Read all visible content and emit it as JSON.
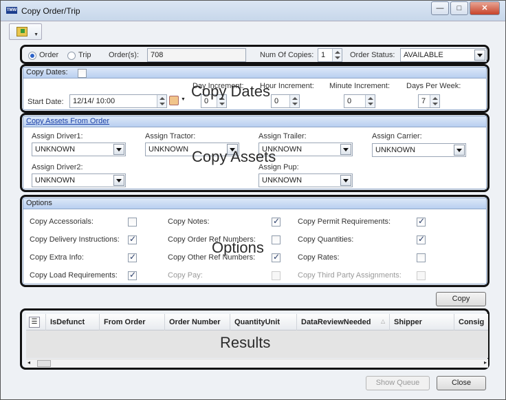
{
  "window": {
    "title": "Copy Order/Trip",
    "icon_label": "TMW"
  },
  "header": {
    "order_radio": "Order",
    "trip_radio": "Trip",
    "orders_label": "Order(s):",
    "orders_value": "708",
    "copies_label": "Num Of Copies:",
    "copies_value": "1",
    "status_label": "Order Status:",
    "status_value": "AVAILABLE"
  },
  "copy_dates": {
    "title": "Copy Dates:",
    "overlay": "Copy Dates",
    "start_date_label": "Start Date:",
    "start_date_value": "12/14/    10:00",
    "day_inc_label": "Day Increment:",
    "day_inc_value": "0",
    "hour_inc_label": "Hour Increment:",
    "hour_inc_value": "0",
    "minute_inc_label": "Minute Increment:",
    "minute_inc_value": "0",
    "days_per_week_label": "Days Per Week:",
    "days_per_week_value": "7"
  },
  "copy_assets": {
    "title": "Copy Assets From Order",
    "overlay": "Copy Assets",
    "driver1_label": "Assign Driver1:",
    "driver1_value": "UNKNOWN",
    "tractor_label": "Assign Tractor:",
    "tractor_value": "UNKNOWN",
    "trailer_label": "Assign Trailer:",
    "trailer_value": "UNKNOWN",
    "carrier_label": "Assign Carrier:",
    "carrier_value": "UNKNOWN",
    "driver2_label": "Assign Driver2:",
    "driver2_value": "UNKNOWN",
    "pup_label": "Assign Pup:",
    "pup_value": "UNKNOWN"
  },
  "options": {
    "title": "Options",
    "overlay": "Options",
    "col1": [
      {
        "label": "Copy Accessorials:",
        "checked": false
      },
      {
        "label": "Copy Delivery Instructions:",
        "checked": true
      },
      {
        "label": "Copy Extra Info:",
        "checked": true
      },
      {
        "label": "Copy Load Requirements:",
        "checked": true
      }
    ],
    "col2": [
      {
        "label": "Copy Notes:",
        "checked": true
      },
      {
        "label": "Copy Order Ref Numbers:",
        "checked": false
      },
      {
        "label": "Copy Other Ref Numbers:",
        "checked": true
      },
      {
        "label": "Copy Pay:",
        "checked": false,
        "disabled": true
      }
    ],
    "col3": [
      {
        "label": "Copy Permit Requirements:",
        "checked": true
      },
      {
        "label": "Copy Quantities:",
        "checked": true
      },
      {
        "label": "Copy Rates:",
        "checked": false
      },
      {
        "label": "Copy Third Party Assignments:",
        "checked": false,
        "disabled": true
      }
    ]
  },
  "copy_button": "Copy",
  "results": {
    "overlay": "Results",
    "columns": [
      "IsDefunct",
      "From Order",
      "Order Number",
      "QuantityUnit",
      "DataReviewNeeded",
      "Shipper",
      "Consig"
    ]
  },
  "footer": {
    "show_queue": "Show Queue",
    "close": "Close"
  }
}
